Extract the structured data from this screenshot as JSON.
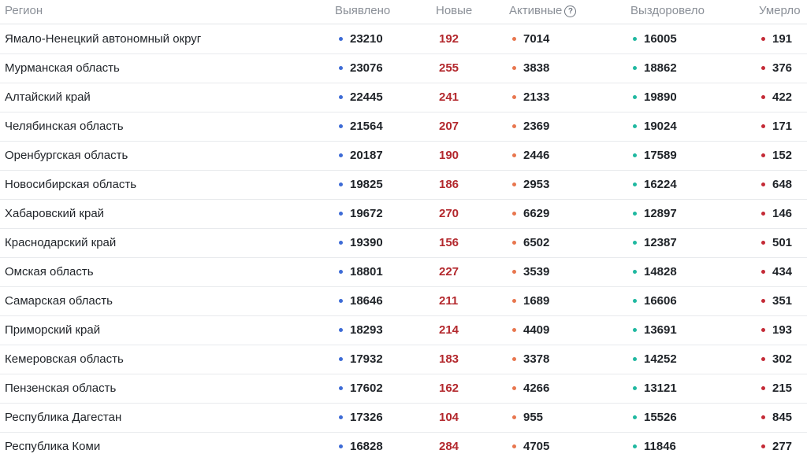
{
  "header": {
    "region": "Регион",
    "detected": "Выявлено",
    "new": "Новые",
    "active": "Активные",
    "active_help_icon": "?",
    "recovered": "Выздоровело",
    "died": "Умерло"
  },
  "colors": {
    "detected": "#3d6bd6",
    "active": "#e8764e",
    "recovered": "#1fb8a0",
    "died": "#c42a36",
    "new": "#b3282d"
  },
  "rows": [
    {
      "region": "Ямало-Ненецкий автономный округ",
      "detected": "23210",
      "new": "192",
      "active": "7014",
      "recovered": "16005",
      "died": "191"
    },
    {
      "region": "Мурманская область",
      "detected": "23076",
      "new": "255",
      "active": "3838",
      "recovered": "18862",
      "died": "376"
    },
    {
      "region": "Алтайский край",
      "detected": "22445",
      "new": "241",
      "active": "2133",
      "recovered": "19890",
      "died": "422"
    },
    {
      "region": "Челябинская область",
      "detected": "21564",
      "new": "207",
      "active": "2369",
      "recovered": "19024",
      "died": "171"
    },
    {
      "region": "Оренбургская область",
      "detected": "20187",
      "new": "190",
      "active": "2446",
      "recovered": "17589",
      "died": "152"
    },
    {
      "region": "Новосибирская область",
      "detected": "19825",
      "new": "186",
      "active": "2953",
      "recovered": "16224",
      "died": "648"
    },
    {
      "region": "Хабаровский край",
      "detected": "19672",
      "new": "270",
      "active": "6629",
      "recovered": "12897",
      "died": "146"
    },
    {
      "region": "Краснодарский край",
      "detected": "19390",
      "new": "156",
      "active": "6502",
      "recovered": "12387",
      "died": "501"
    },
    {
      "region": "Омская область",
      "detected": "18801",
      "new": "227",
      "active": "3539",
      "recovered": "14828",
      "died": "434"
    },
    {
      "region": "Самарская область",
      "detected": "18646",
      "new": "211",
      "active": "1689",
      "recovered": "16606",
      "died": "351"
    },
    {
      "region": "Приморский край",
      "detected": "18293",
      "new": "214",
      "active": "4409",
      "recovered": "13691",
      "died": "193"
    },
    {
      "region": "Кемеровская область",
      "detected": "17932",
      "new": "183",
      "active": "3378",
      "recovered": "14252",
      "died": "302"
    },
    {
      "region": "Пензенская область",
      "detected": "17602",
      "new": "162",
      "active": "4266",
      "recovered": "13121",
      "died": "215"
    },
    {
      "region": "Республика Дагестан",
      "detected": "17326",
      "new": "104",
      "active": "955",
      "recovered": "15526",
      "died": "845"
    },
    {
      "region": "Республика Коми",
      "detected": "16828",
      "new": "284",
      "active": "4705",
      "recovered": "11846",
      "died": "277"
    }
  ]
}
